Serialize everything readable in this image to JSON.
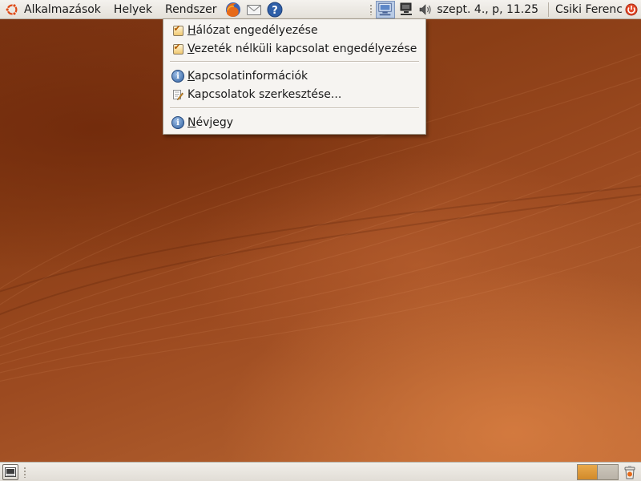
{
  "top_panel": {
    "menus": {
      "applications": "Alkalmazások",
      "places": "Helyek",
      "system": "Rendszer"
    },
    "launchers": [
      "firefox-icon",
      "mail-icon",
      "help-icon"
    ],
    "tray": {
      "icons": [
        "network-manager-icon",
        "network-wired-icon",
        "volume-icon"
      ],
      "clock": "szept.  4., p, 11.25",
      "user": "Csiki Ferenc"
    }
  },
  "network_menu": {
    "items": [
      {
        "label": "Hálózat engedélyezése",
        "mnemonic": "H",
        "rest": "álózat engedélyezése",
        "icon": "checkbox-checked-icon",
        "checked": true
      },
      {
        "label": "Vezeték nélküli kapcsolat engedélyezése",
        "mnemonic": "V",
        "rest": "ezeték nélküli kapcsolat engedélyezése",
        "icon": "checkbox-checked-icon",
        "checked": true
      },
      {
        "label": "Kapcsolatinformációk",
        "mnemonic": "K",
        "rest": "apcsolatinformációk",
        "icon": "info-icon"
      },
      {
        "label": "Kapcsolatok szerkesztése...",
        "icon": "edit-icon"
      },
      {
        "label": "Névjegy",
        "mnemonic": "N",
        "rest": "évjegy",
        "icon": "about-icon"
      }
    ]
  },
  "bottom_panel": {
    "workspaces": [
      {
        "active": true,
        "color": "#d99638"
      },
      {
        "active": false,
        "color": "#c2bbb0"
      }
    ]
  },
  "colors": {
    "accent": "#e05a1c",
    "panel": "#ece9e4",
    "desktop": "#8a3e16"
  }
}
